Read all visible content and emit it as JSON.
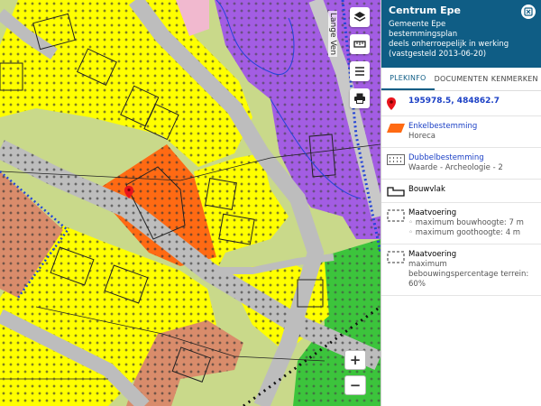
{
  "map": {
    "scale_text": "Lange Ven",
    "zoom_in": "+",
    "zoom_out": "−"
  },
  "panel": {
    "title": "Centrum Epe",
    "municipality": "Gemeente Epe",
    "plan_type": "bestemmingsplan",
    "status": "deels onherroepelijk in werking (vastgesteld 2013-06-20)",
    "tabs": [
      {
        "label": "PLEKINFO"
      },
      {
        "label": "DOCUMENTEN"
      },
      {
        "label": "KENMERKEN"
      }
    ],
    "coordinates": "195978.5, 484862.7",
    "enkel": {
      "title": "Enkelbestemming",
      "value": "Horeca"
    },
    "dubbel": {
      "title": "Dubbelbestemming",
      "value": "Waarde - Archeologie - 2"
    },
    "bouwvlak": {
      "title": "Bouwvlak"
    },
    "maat1": {
      "title": "Maatvoering",
      "items": [
        "maximum bouwhoogte: 7 m",
        "maximum goothoogte: 4 m"
      ]
    },
    "maat2": {
      "title": "Maatvoering",
      "items": [
        "maximum bebouwingspercentage terrein: 60%"
      ]
    }
  },
  "colors": {
    "header": "#0f5d85",
    "link": "#1a3fc5",
    "horeca": "#ff6a13"
  }
}
